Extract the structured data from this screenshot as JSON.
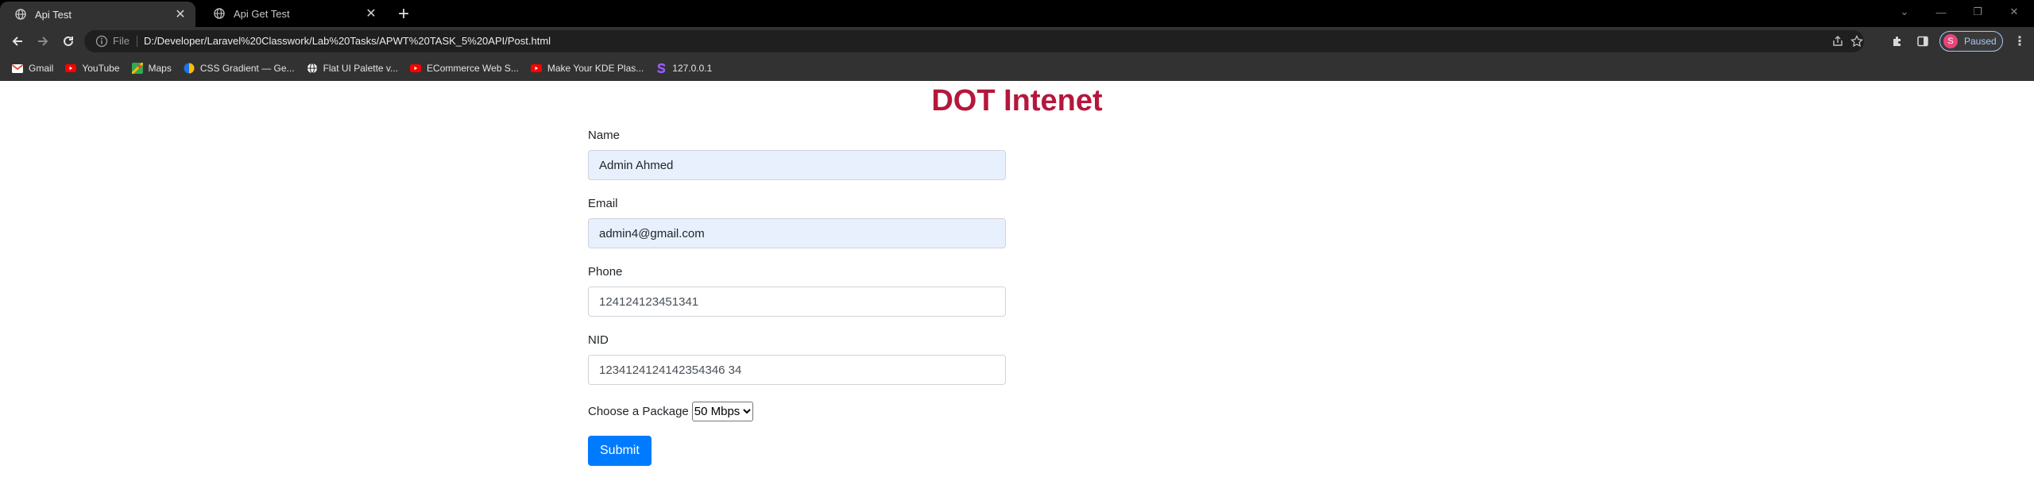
{
  "browser": {
    "tabs": [
      {
        "title": "Api Test",
        "active": true
      },
      {
        "title": "Api Get Test",
        "active": false
      }
    ],
    "address": {
      "scheme_label": "File",
      "url": "D:/Developer/Laravel%20Classwork/Lab%20Tasks/APWT%20TASK_5%20API/Post.html"
    },
    "profile": {
      "initial": "S",
      "status": "Paused"
    },
    "bookmarks": [
      {
        "label": "Gmail",
        "icon": "gmail-icon",
        "color": "#ea4335"
      },
      {
        "label": "YouTube",
        "icon": "youtube-icon",
        "color": "#ff0000"
      },
      {
        "label": "Maps",
        "icon": "maps-icon",
        "color": "#34a853"
      },
      {
        "label": "CSS Gradient — Ge...",
        "icon": "css-gradient-icon",
        "color": "#1a73e8"
      },
      {
        "label": "Flat UI Palette v...",
        "icon": "globe-icon",
        "color": "#e0e0e0"
      },
      {
        "label": "ECommerce Web S...",
        "icon": "youtube-icon",
        "color": "#ff0000"
      },
      {
        "label": "Make Your KDE Plas...",
        "icon": "youtube-icon",
        "color": "#ff0000"
      },
      {
        "label": "127.0.0.1",
        "icon": "s-logo-icon",
        "color": "#7b3fe4"
      }
    ]
  },
  "page": {
    "heading": "DOT Intenet",
    "fields": {
      "name": {
        "label": "Name",
        "value": "Admin Ahmed"
      },
      "email": {
        "label": "Email",
        "value": "admin4@gmail.com"
      },
      "phone": {
        "label": "Phone",
        "value": "124124123451341"
      },
      "nid": {
        "label": "NID",
        "value": "1234124124142354346 34"
      }
    },
    "package": {
      "label": "Choose a Package",
      "selected": "50 Mbps"
    },
    "submit_label": "Submit"
  },
  "colors": {
    "heading": "#b5173c",
    "submit": "#007bff",
    "autofill": "#e8f0fe"
  }
}
